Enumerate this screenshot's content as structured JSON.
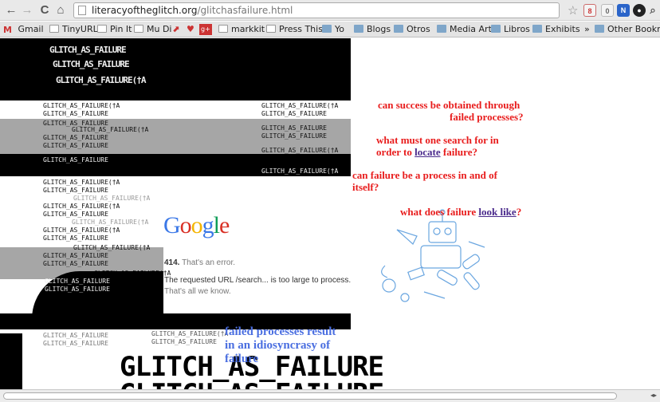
{
  "browser": {
    "url_host": "literacyoftheglitch.org",
    "url_path": "/glitchasfailure.html",
    "back": "←",
    "forward": "→",
    "reload": "C",
    "home": "⌂",
    "star": "☆"
  },
  "bookmarks": [
    {
      "label": "Gmail",
      "icon": "gmail-icon"
    },
    {
      "label": "TinyURL!",
      "icon": "page-icon"
    },
    {
      "label": "Pin It",
      "icon": "page-icon"
    },
    {
      "label": "Mu Di",
      "icon": "page-icon"
    },
    {
      "label": "markkit",
      "icon": "page-icon"
    },
    {
      "label": "Press This",
      "icon": "page-icon"
    },
    {
      "label": "Yo",
      "icon": "folder-icon"
    },
    {
      "label": "Blogs",
      "icon": "folder-icon"
    },
    {
      "label": "Otros",
      "icon": "folder-icon"
    },
    {
      "label": "Media Art",
      "icon": "folder-icon"
    },
    {
      "label": "Libros",
      "icon": "folder-icon"
    },
    {
      "label": "Exhibits",
      "icon": "folder-icon"
    }
  ],
  "bookmarks_overflow": "»",
  "other_bookmarks": "Other Bookmarks",
  "glitch_token": "GLITCH_AS_FAILURE",
  "glitch_token_cursor": "GLITCH_AS_FAILURE(†A",
  "questions": {
    "q1_line1": "can success be obtained through",
    "q1_line2": "failed processes?",
    "q2_line1": "what must one search for in",
    "q2_line2_pre": "order to ",
    "q2_link": "locate",
    "q2_line2_post": " failure?",
    "q3_line1": "can failure be a process in and of",
    "q3_line2": "itself?",
    "q4_pre": "what does failure ",
    "q4_link": "look like",
    "q4_post": "?"
  },
  "google_error": {
    "logo": "Google",
    "code": "414.",
    "headline": "That's an error.",
    "message": "The requested URL /search... is too large to process.",
    "sub": "That's all we know."
  },
  "blue_question": {
    "line1": "failed processes result",
    "line2": "in an idiosyncrasy of",
    "line3": "failure"
  },
  "big_text": "GLITCH_AS_FAILURE",
  "colors": {
    "question_red": "#e81c1c",
    "link_purple": "#4a2a8c",
    "blue": "#4a6ee0"
  }
}
